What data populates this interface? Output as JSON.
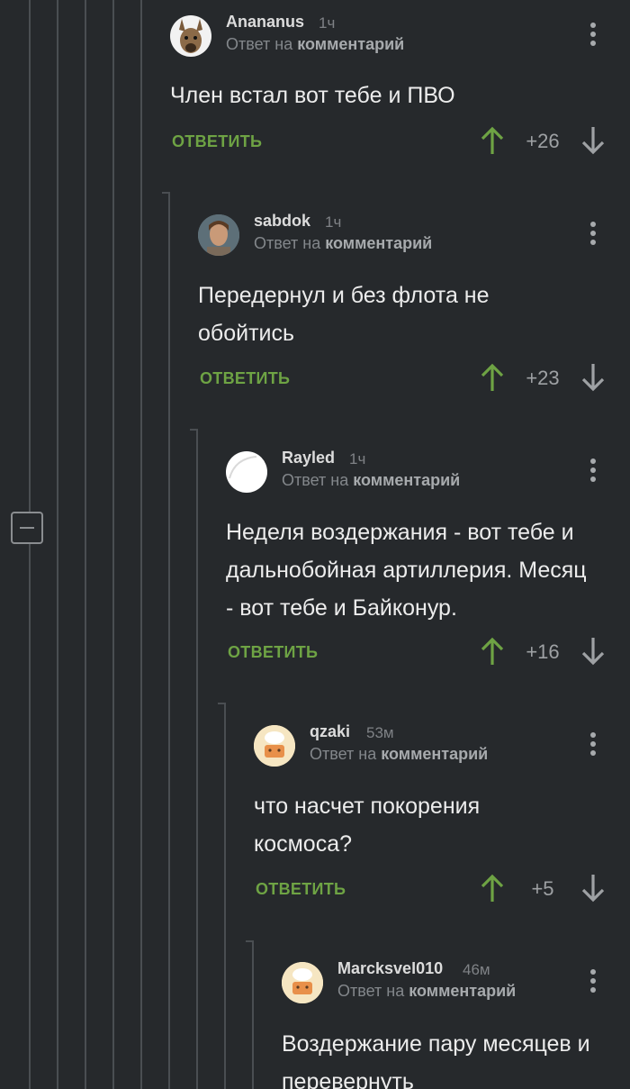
{
  "theme": {
    "background": "#26292c",
    "accent_green": "#6ea344",
    "line": "#4a4e52",
    "text": "#ececec",
    "muted": "#83878b"
  },
  "reply_to_prefix": "Ответ на",
  "reply_to_link": "комментарий",
  "reply_label": "ОТВЕТИТЬ",
  "icons": {
    "upvote": "arrow-up-icon",
    "downvote": "arrow-down-icon",
    "more": "more-vertical-icon",
    "collapse": "collapse-minus-icon"
  },
  "comments": [
    {
      "author": "Anananus",
      "time": "1ч",
      "text": "Член встал вот тебе и ПВО",
      "score": "+26"
    },
    {
      "author": "sabdok",
      "time": "1ч",
      "text": "Передернул и без флота не обойтись",
      "score": "+23"
    },
    {
      "author": "Rayled",
      "time": "1ч",
      "text": "Неделя воздержания - вот тебе и дальнобойная артиллерия. Месяц - вот тебе и Байконур.",
      "score": "+16"
    },
    {
      "author": "qzaki",
      "time": "53м",
      "text": "что насчет покорения космоса?",
      "score": "+5"
    },
    {
      "author": "Marcksvel010",
      "time": "46м",
      "text": "Воздержание пару месяцев и перевернуть",
      "score": ""
    }
  ]
}
